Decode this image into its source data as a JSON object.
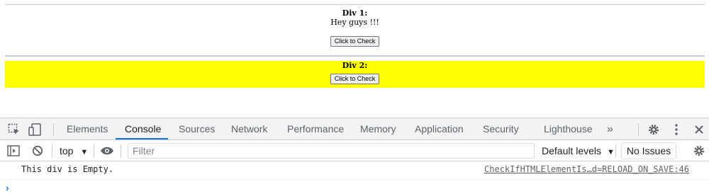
{
  "page": {
    "div1": {
      "label": "Div 1:",
      "text": "Hey guys !!!",
      "button": "Click to Check"
    },
    "div2": {
      "label": "Div 2:",
      "button": "Click to Check",
      "background": "#ffff00"
    }
  },
  "devtools": {
    "tabs": [
      "Elements",
      "Console",
      "Sources",
      "Network",
      "Performance",
      "Memory",
      "Application",
      "Security",
      "Lighthouse"
    ],
    "active_tab": "Console",
    "more_tabs": "»",
    "toolbar": {
      "context": "top",
      "filter_placeholder": "Filter",
      "levels": "Default levels",
      "issues": "No Issues"
    },
    "console": {
      "message": "This div is Empty.",
      "source": "CheckIfHTMLElementIs…d=RELOAD_ON_SAVE:46",
      "prompt": "›"
    },
    "accent": "#1a73e8"
  }
}
